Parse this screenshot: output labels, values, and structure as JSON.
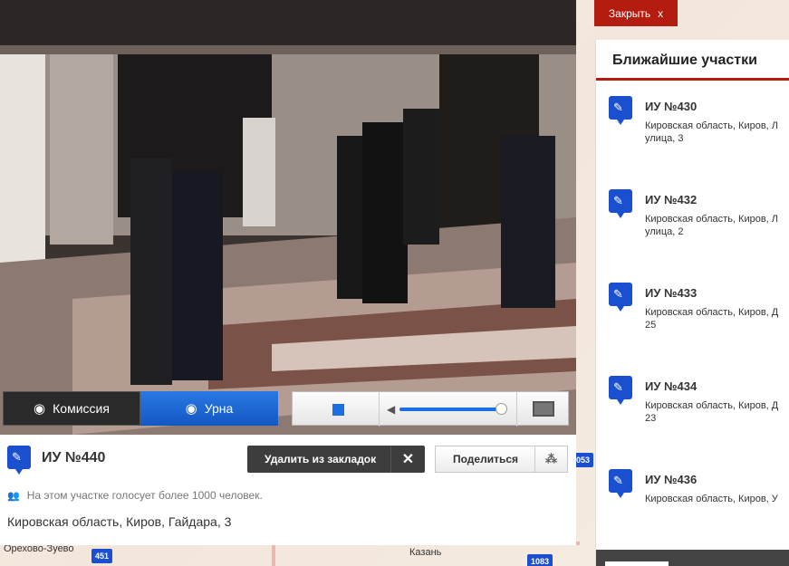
{
  "map": {
    "labels": [
      "Орехово-Зуево",
      "Казань"
    ],
    "markers": [
      "451",
      "1083",
      "053"
    ]
  },
  "video": {
    "tabs": {
      "commission": "Комиссия",
      "urna": "Урна"
    }
  },
  "close_button": {
    "label": "Закрыть",
    "icon": "x"
  },
  "station": {
    "title": "ИУ №440",
    "remove_bookmark": "Удалить из закладок",
    "share": "Поделиться",
    "voters_note": "На этом участке голосует более 1000 человек.",
    "address": "Кировская область, Киров, Гайдара, 3"
  },
  "nearby": {
    "title": "Ближайшие участки",
    "items": [
      {
        "title": "ИУ №430",
        "addr1": "Кировская область, Киров, Л",
        "addr2": "улица, 3"
      },
      {
        "title": "ИУ №432",
        "addr1": "Кировская область, Киров, Л",
        "addr2": "улица, 2"
      },
      {
        "title": "ИУ №433",
        "addr1": "Кировская область, Киров, Д",
        "addr2": "25"
      },
      {
        "title": "ИУ №434",
        "addr1": "Кировская область, Киров, Д",
        "addr2": "23"
      },
      {
        "title": "ИУ №436",
        "addr1": "Кировская область, Киров, У",
        "addr2": ""
      }
    ]
  },
  "colors": {
    "accent": "#1a4fd0",
    "brand_red": "#b51c10",
    "urna_active": "#1c6fe0"
  }
}
